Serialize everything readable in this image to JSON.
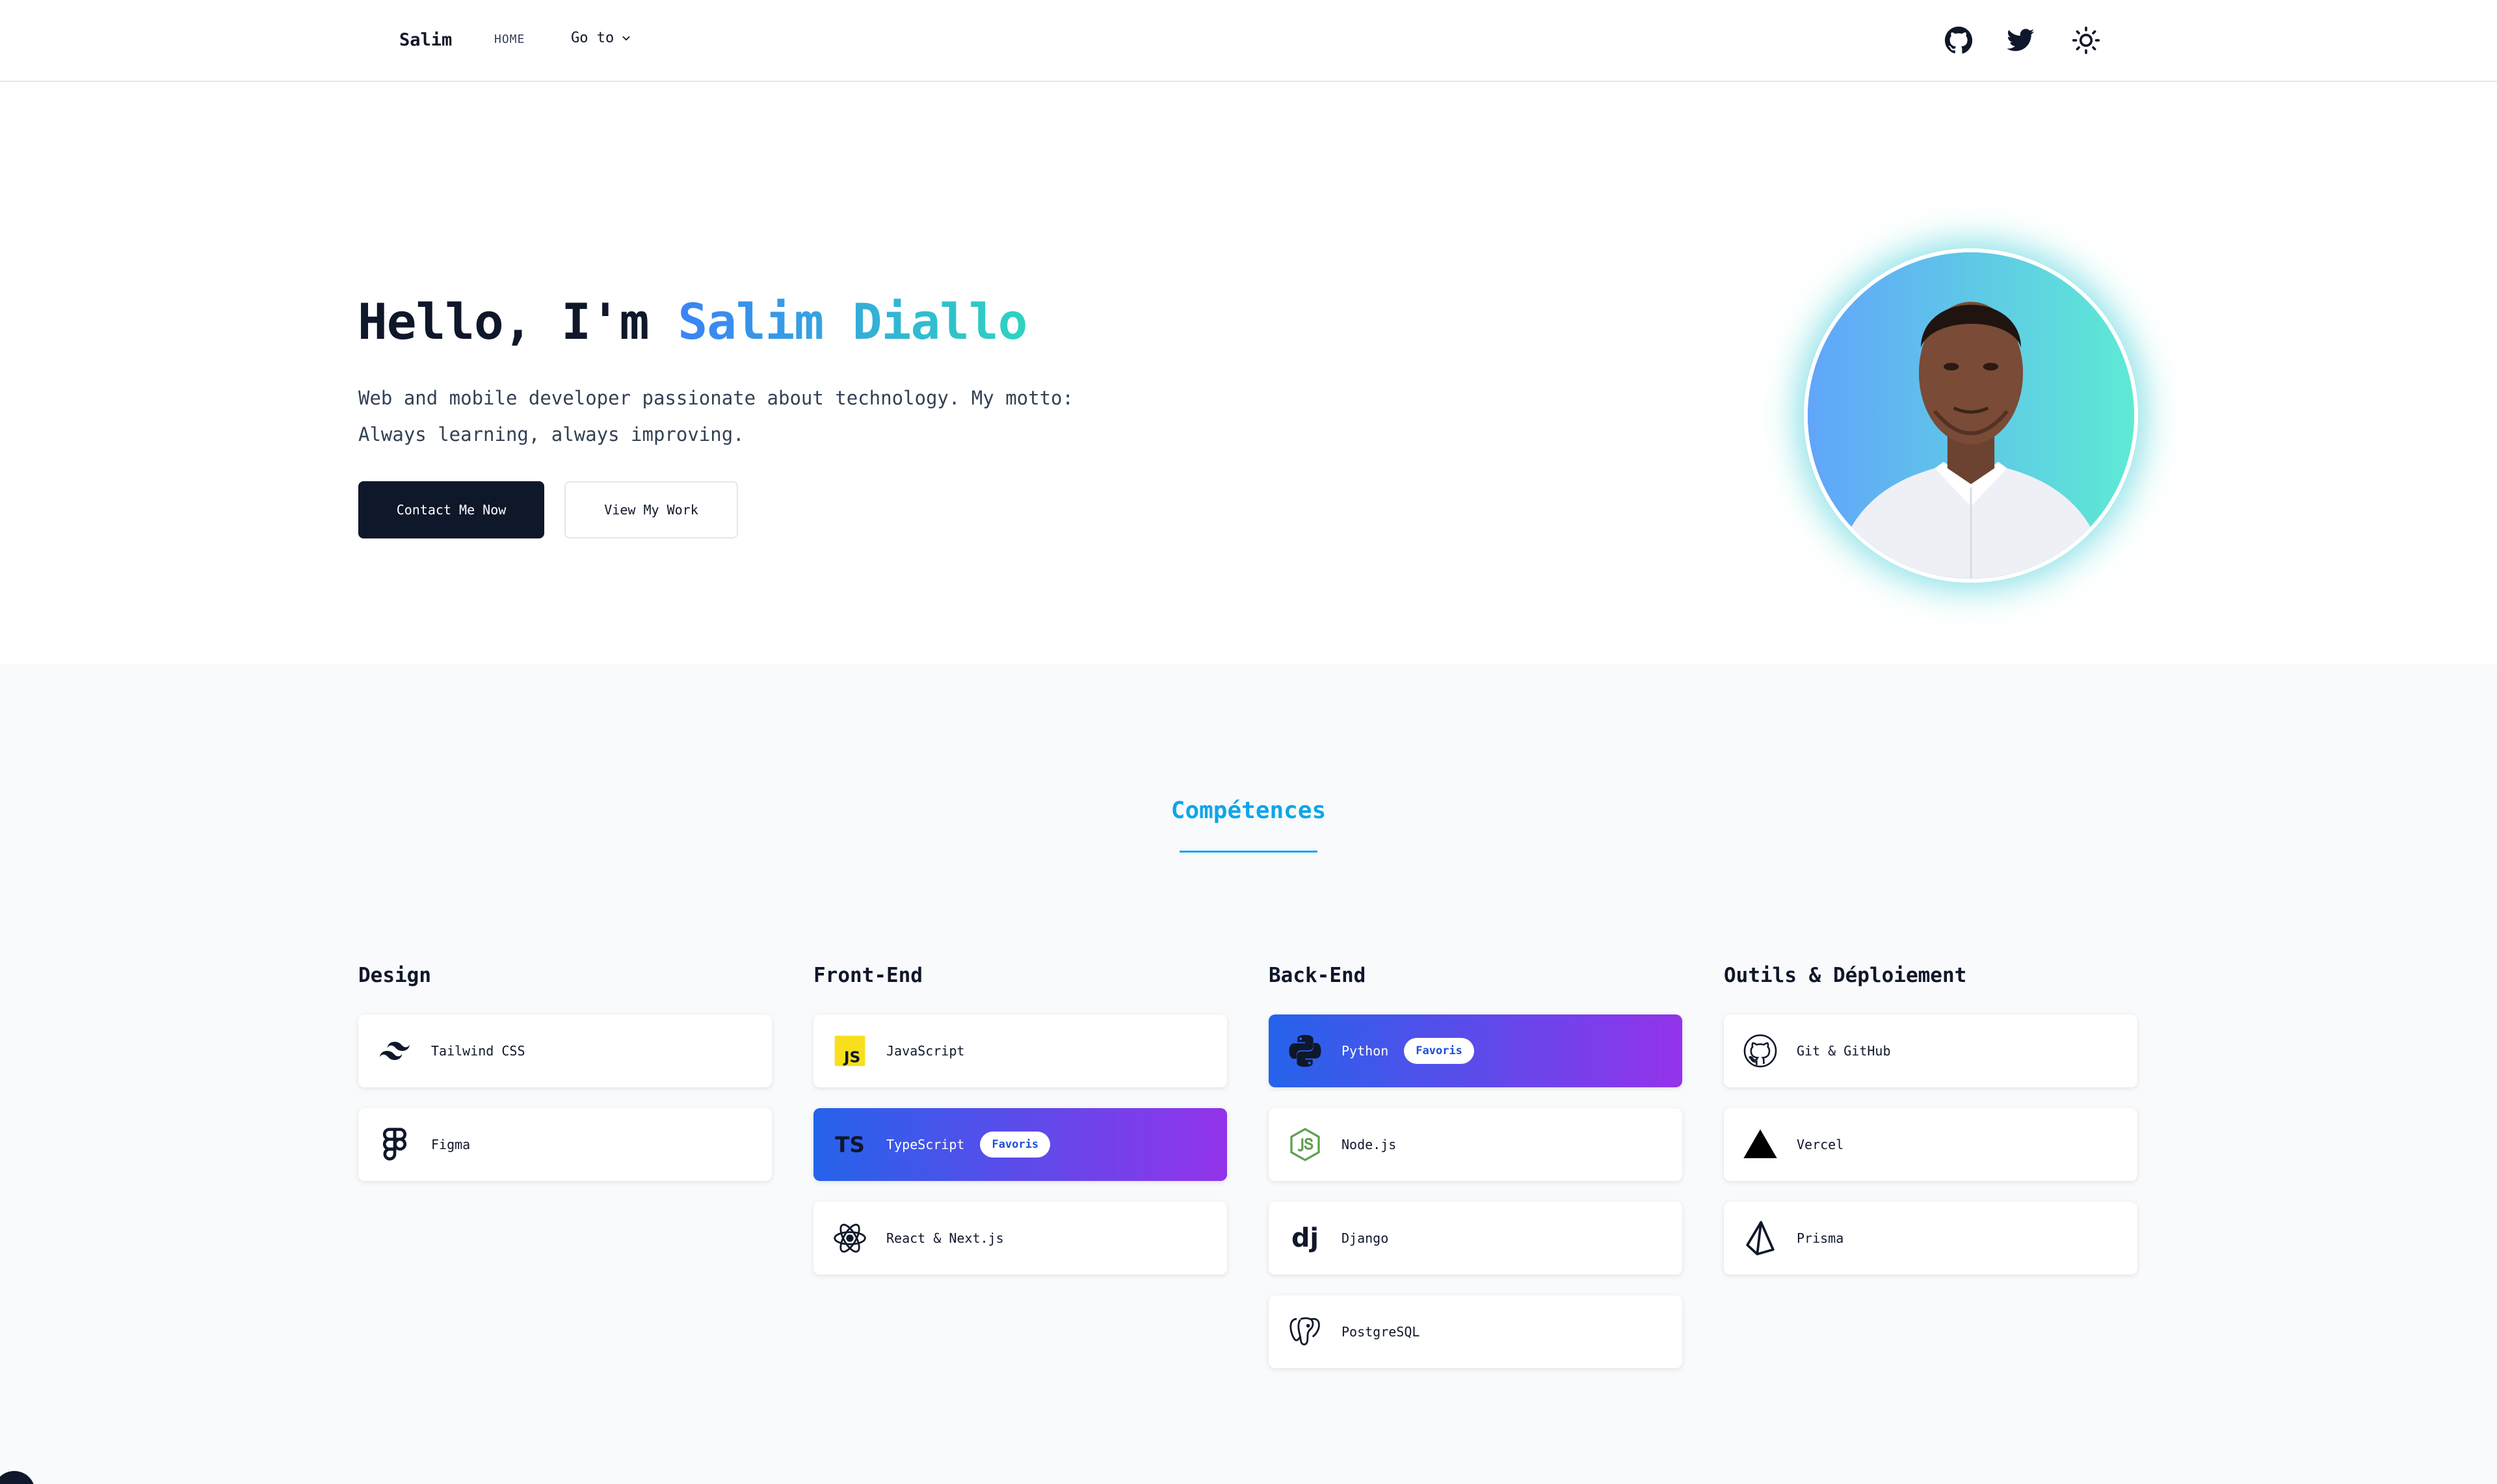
{
  "nav": {
    "brand": "Salim",
    "home": "HOME",
    "goto": "Go to",
    "icons": [
      "github-icon",
      "twitter-icon",
      "sun-icon"
    ]
  },
  "hero": {
    "greeting": "Hello, I'm ",
    "name": "Salim Diallo",
    "subtitle": "Web and mobile developer passionate about technology. My motto: Always learning, always improving.",
    "contact_label": "Contact Me Now",
    "work_label": "View My Work"
  },
  "skills": {
    "heading": "Compétences",
    "columns": [
      {
        "title": "Design",
        "items": [
          {
            "label": "Tailwind CSS",
            "icon": "tailwind-icon"
          },
          {
            "label": "Figma",
            "icon": "figma-icon"
          }
        ]
      },
      {
        "title": "Front-End",
        "items": [
          {
            "label": "JavaScript",
            "icon": "javascript-icon"
          },
          {
            "label": "TypeScript",
            "icon": "typescript-icon",
            "badge": "Favoris"
          },
          {
            "label": "React & Next.js",
            "icon": "react-icon"
          }
        ]
      },
      {
        "title": "Back-End",
        "items": [
          {
            "label": "Python",
            "icon": "python-icon",
            "badge": "Favoris"
          },
          {
            "label": "Node.js",
            "icon": "nodejs-icon"
          },
          {
            "label": "Django",
            "icon": "django-icon"
          },
          {
            "label": "PostgreSQL",
            "icon": "postgresql-icon"
          }
        ]
      },
      {
        "title": "Outils & Déploiement",
        "items": [
          {
            "label": "Git & GitHub",
            "icon": "github-icon"
          },
          {
            "label": "Vercel",
            "icon": "vercel-icon"
          },
          {
            "label": "Prisma",
            "icon": "prisma-icon"
          }
        ]
      }
    ]
  },
  "colors": {
    "accent": "#0ea5e9",
    "primary_dark": "#0f172a",
    "favorite_gradient_start": "#2563eb",
    "favorite_gradient_end": "#9333ea"
  }
}
